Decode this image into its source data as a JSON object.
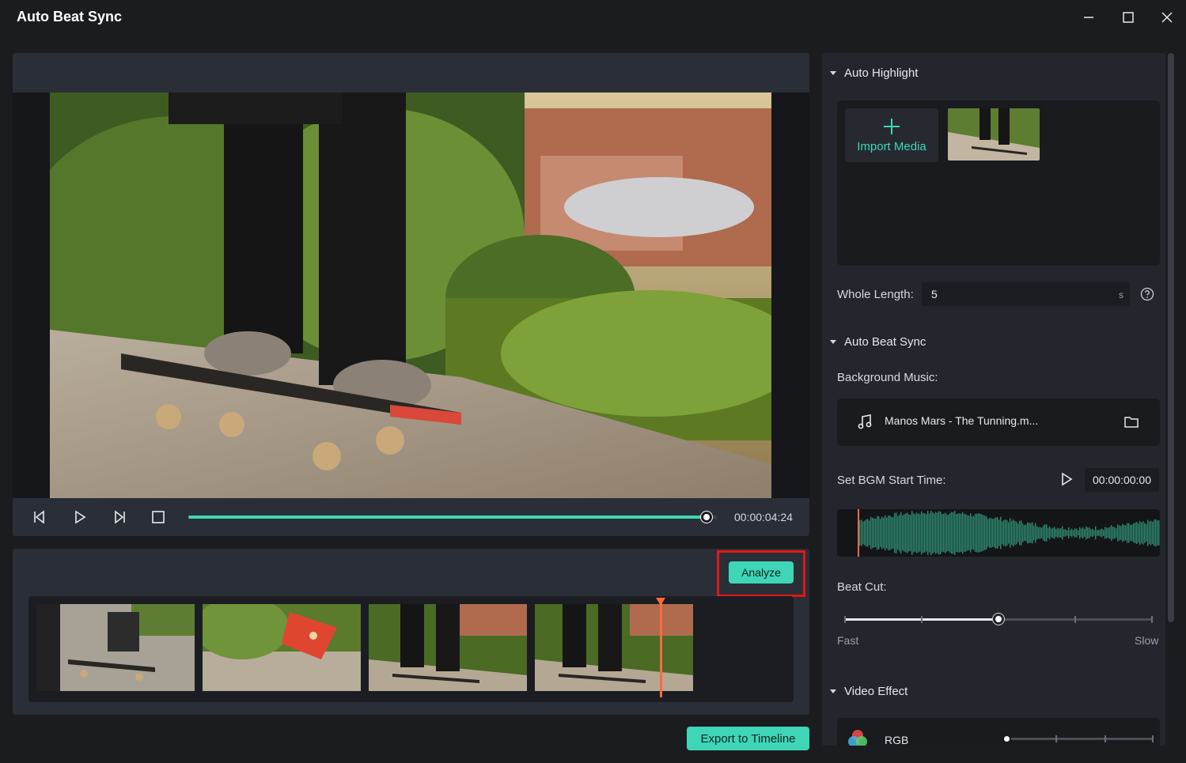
{
  "window": {
    "title": "Auto Beat Sync",
    "minimize_icon": "minimize-icon",
    "maximize_icon": "maximize-icon",
    "close_icon": "close-icon"
  },
  "player": {
    "time": "00:00:04:24",
    "progress": 0.98
  },
  "actions": {
    "analyze_label": "Analyze",
    "export_label": "Export to Timeline"
  },
  "right": {
    "auto_highlight": {
      "title": "Auto Highlight",
      "import_label": "Import Media",
      "whole_length_label": "Whole Length:",
      "whole_length_value": "5",
      "whole_length_unit": "s"
    },
    "auto_beat_sync": {
      "title": "Auto Beat Sync",
      "bg_music_label": "Background Music:",
      "music_name": "Manos Mars - The Tunning.m...",
      "bgm_start_label": "Set BGM Start Time:",
      "bgm_start_time": "00:00:00:00",
      "beat_cut_label": "Beat Cut:",
      "fast_label": "Fast",
      "slow_label": "Slow",
      "beat_cut_value": 0.5
    },
    "video_effect": {
      "title": "Video Effect",
      "effect_name": "RGB"
    }
  },
  "colors": {
    "accent": "#3ed6b6",
    "highlight_box": "#e0191a",
    "playhead": "#ff6b3d",
    "waveform": "#2f8a72"
  }
}
